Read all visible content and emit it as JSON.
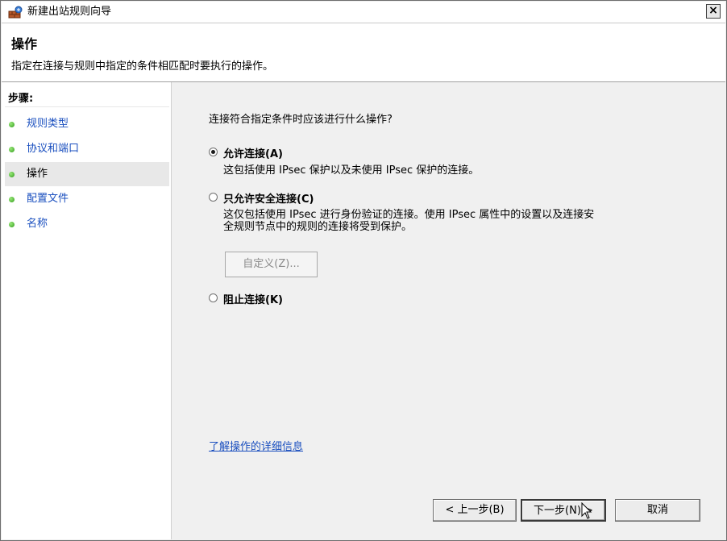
{
  "window": {
    "title": "新建出站规则向导",
    "close_label": "×"
  },
  "header": {
    "title": "操作",
    "subtitle": "指定在连接与规则中指定的条件相匹配时要执行的操作。"
  },
  "steps": {
    "title": "步骤:",
    "items": [
      {
        "label": "规则类型",
        "current": false
      },
      {
        "label": "协议和端口",
        "current": false
      },
      {
        "label": "操作",
        "current": true
      },
      {
        "label": "配置文件",
        "current": false
      },
      {
        "label": "名称",
        "current": false
      }
    ]
  },
  "main": {
    "question": "连接符合指定条件时应该进行什么操作?",
    "options": [
      {
        "label": "允许连接(A)",
        "desc": "这包括使用 IPsec 保护以及未使用 IPsec 保护的连接。",
        "selected": true
      },
      {
        "label": "只允许安全连接(C)",
        "desc_line1": "这仅包括使用 IPsec 进行身份验证的连接。使用 IPsec 属性中的设置以及连接安",
        "desc_line2": "全规则节点中的规则的连接将受到保护。",
        "selected": false
      },
      {
        "label": "阻止连接(K)",
        "selected": false
      }
    ],
    "customize_label": "自定义(Z)...",
    "learn_more_link": "了解操作的详细信息"
  },
  "footer": {
    "back_label": "< 上一步(B)",
    "next_label": "下一步(N) >",
    "cancel_label": "取消"
  },
  "colors": {
    "link": "#1a4fbf",
    "step_dot": "#2f9a1a"
  }
}
